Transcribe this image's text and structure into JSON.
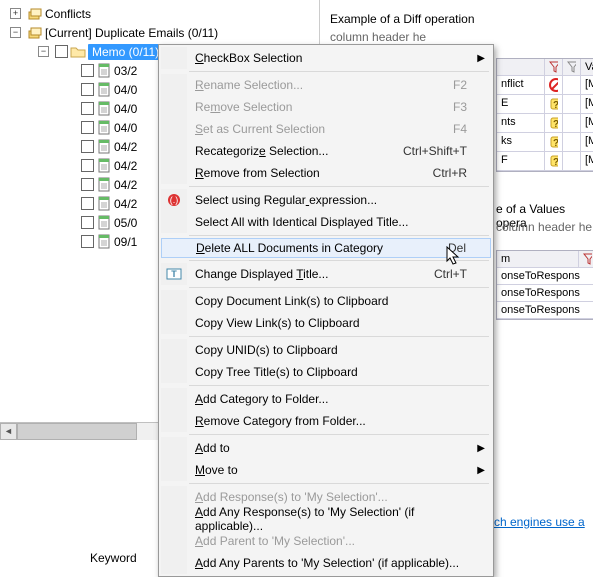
{
  "tree": {
    "root1": "Conflicts",
    "root2": "[Current] Duplicate Emails  (0/11)",
    "folder": "Memo  (0/11)",
    "docs": [
      "03/2",
      "04/0",
      "04/0",
      "04/0",
      "04/2",
      "04/2",
      "04/2",
      "04/2",
      "05/0",
      "09/1"
    ]
  },
  "menu": {
    "items": [
      {
        "label": "CheckBox Selection",
        "sub": true,
        "u": 0
      },
      {
        "sep": true
      },
      {
        "label": "Rename Selection...",
        "u": 0,
        "shortcut": "F2",
        "disabled": true
      },
      {
        "label": "Remove Selection",
        "u": 2,
        "shortcut": "F3",
        "disabled": true
      },
      {
        "label": "Set as Current Selection",
        "u": 0,
        "shortcut": "F4",
        "disabled": true
      },
      {
        "label": "Recategorize Selection...",
        "u": 11,
        "shortcut": "Ctrl+Shift+T"
      },
      {
        "label": "Remove from Selection",
        "u": 0,
        "shortcut": "Ctrl+R"
      },
      {
        "sep": true
      },
      {
        "label": "Select using Regular expression...",
        "u": 20,
        "icon": "regex"
      },
      {
        "label": "Select All with Identical Displayed Title..."
      },
      {
        "sep": true
      },
      {
        "label": "Delete ALL Documents in Category",
        "u": 0,
        "shortcut": "Del",
        "hl": true
      },
      {
        "sep": true
      },
      {
        "label": "Change Displayed Title...",
        "u": 17,
        "shortcut": "Ctrl+T",
        "icon": "text"
      },
      {
        "sep": true
      },
      {
        "label": "Copy Document Link(s) to Clipboard"
      },
      {
        "label": "Copy View Link(s) to Clipboard"
      },
      {
        "sep": true
      },
      {
        "label": "Copy UNID(s) to Clipboard"
      },
      {
        "label": "Copy Tree Title(s) to Clipboard"
      },
      {
        "sep": true
      },
      {
        "label": "Add Category to Folder...",
        "u": 0
      },
      {
        "label": "Remove Category from Folder...",
        "u": 0
      },
      {
        "sep": true
      },
      {
        "label": "Add to",
        "u": 0,
        "sub": true
      },
      {
        "label": "Move to",
        "u": 0,
        "sub": true
      },
      {
        "sep": true
      },
      {
        "label": "Add Response(s) to 'My Selection'...",
        "u": 0,
        "disabled": true
      },
      {
        "label": "Add Any Response(s) to 'My Selection' (if applicable)...",
        "u": 0
      },
      {
        "label": "Add Parent to 'My Selection'...",
        "u": 0,
        "disabled": true
      },
      {
        "label": "Add Any Parents to 'My Selection' (if applicable)...",
        "u": 0
      }
    ]
  },
  "right": {
    "top_text": "Example of a Diff operation",
    "hint1": "column header he",
    "table1": {
      "head2": "Valu",
      "rows": [
        {
          "k": "nflict",
          "v": "[Mu",
          "i": "no"
        },
        {
          "k": "E",
          "v": "[Mu",
          "i": "q"
        },
        {
          "k": "nts",
          "v": "[Mu",
          "i": "q"
        },
        {
          "k": "ks",
          "v": "[Mu",
          "i": "q"
        },
        {
          "k": "F",
          "v": "[Mu",
          "i": "q"
        }
      ]
    },
    "mid_text": "e of a Values opera",
    "hint2": "column header he",
    "header_m": "m",
    "list2": [
      "onseToRespons",
      "onseToRespons",
      "onseToRespons"
    ],
    "bottom_link": "rch engines use a",
    "keyword_label": "Keyword"
  }
}
